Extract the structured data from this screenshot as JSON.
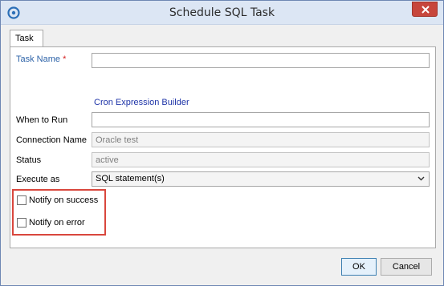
{
  "window": {
    "title": "Schedule SQL Task"
  },
  "tabs": [
    {
      "label": "Task"
    }
  ],
  "form": {
    "task_name": {
      "label": "Task Name",
      "required_mark": "*",
      "value": ""
    },
    "cron_link": "Cron Expression Builder",
    "when_to_run": {
      "label": "When to Run",
      "value": ""
    },
    "connection_name": {
      "label": "Connection Name",
      "value": "Oracle test"
    },
    "status": {
      "label": "Status",
      "value": "active"
    },
    "execute_as": {
      "label": "Execute as",
      "value": "SQL statement(s)"
    },
    "notify_success": {
      "label": "Notify on success",
      "checked": false
    },
    "notify_error": {
      "label": "Notify on error",
      "checked": false
    }
  },
  "buttons": {
    "ok": "OK",
    "cancel": "Cancel"
  },
  "colors": {
    "titlebar": "#dce6f4",
    "close": "#c7463c",
    "required_label": "#2d63a8",
    "link": "#1f35a8",
    "highlight": "#d9473d"
  },
  "icons": {
    "app": "app-logo-icon",
    "close": "close-icon",
    "dropdown": "chevron-down-icon"
  }
}
